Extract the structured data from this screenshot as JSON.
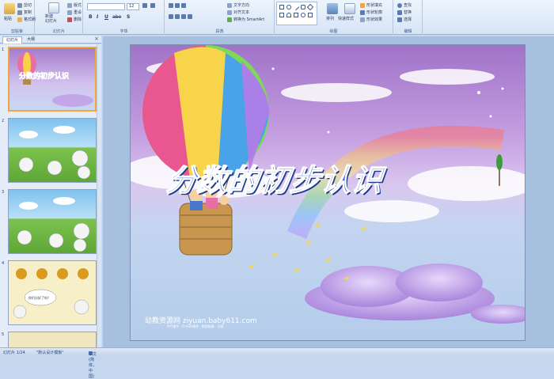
{
  "ribbon": {
    "clipboard": {
      "paste": "粘贴",
      "cut": "剪切",
      "copy": "复制",
      "format_painter": "格式刷",
      "label": "剪贴板"
    },
    "slides": {
      "new_slide": "新建\n幻灯片",
      "layout": "版式",
      "reset": "重设",
      "delete": "删除",
      "label": "幻灯片"
    },
    "font": {
      "font_name": "",
      "font_size": "12",
      "bold": "B",
      "italic": "I",
      "underline": "U",
      "strike": "abe",
      "shadow": "S",
      "label": "字体"
    },
    "paragraph": {
      "text_direction": "文字方向",
      "align_text": "对齐文本",
      "smartart": "转换为 SmartArt",
      "label": "段落"
    },
    "drawing": {
      "arrange": "排列",
      "quick_styles": "快速样式",
      "shape_fill": "形状填充",
      "shape_outline": "形状轮廓",
      "shape_effects": "形状效果",
      "label": "绘图"
    },
    "editing": {
      "find": "查找",
      "replace": "替换",
      "select": "选择",
      "label": "编辑"
    }
  },
  "panel": {
    "tab_slides": "幻灯片",
    "tab_outline": "大纲",
    "close": "×"
  },
  "thumbnails": [
    {
      "num": "1",
      "title": "分数的初步认识"
    },
    {
      "num": "2"
    },
    {
      "num": "3"
    },
    {
      "num": "4",
      "bubble": "你们分好了吗？"
    },
    {
      "num": "5"
    }
  ],
  "slide": {
    "title": "分数的初步认识",
    "watermark_main": "幼教资源网 ziyuan.baby611.com",
    "watermark_sub": "PPT课件 · FLASH课件 · 教案故事 · 试卷"
  },
  "status": {
    "slide_pos": "幻灯片 1/24",
    "theme": "\"默认设计模板\"",
    "lang": "中文(简体，中国)"
  },
  "colors": {
    "title_fill": "#3a63d8",
    "title_outline": "#ffffff",
    "selection": "#f2a53a"
  },
  "icons": [
    "paste-icon",
    "new-slide-icon",
    "shapes-icon",
    "find-icon",
    "balloon-image",
    "cloud-image",
    "rainbow-image"
  ]
}
